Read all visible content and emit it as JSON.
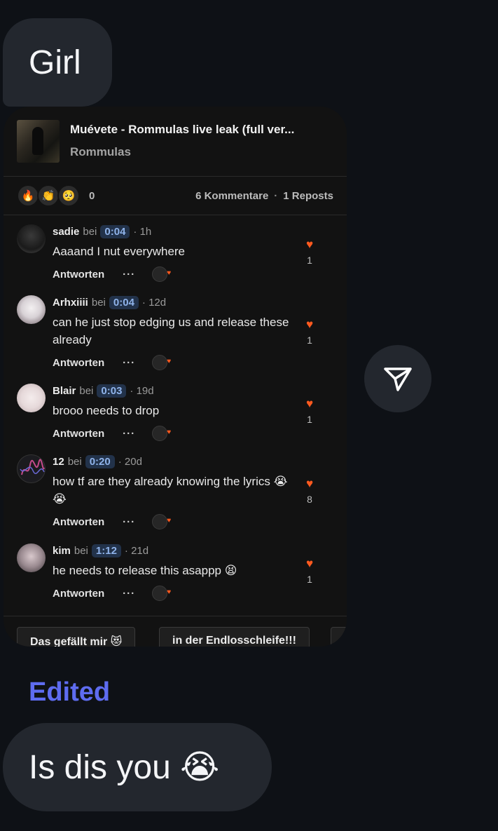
{
  "messages": {
    "top_text": "Girl",
    "edited_label": "Edited",
    "bottom_text": "Is dis you 😭"
  },
  "track": {
    "title": "Muévete - Rommulas live leak (full ver...",
    "artist": "Rommulas"
  },
  "stats": {
    "reactions": [
      "🔥",
      "👏",
      "🥺"
    ],
    "reaction_count": "0",
    "comments": "6 Kommentare",
    "separator": "·",
    "reposts": "1 Reposts"
  },
  "labels": {
    "at": "bei",
    "reply": "Antworten",
    "more": "···"
  },
  "comments": [
    {
      "user": "sadie",
      "time": "0:04",
      "ago": "· 1h",
      "text": "Aaaand I nut everywhere",
      "likes": "1"
    },
    {
      "user": "Arhxiiii",
      "time": "0:04",
      "ago": "· 12d",
      "text": "can he just stop edging us and release these already",
      "likes": "1"
    },
    {
      "user": "Blair",
      "time": "0:03",
      "ago": "· 19d",
      "text": "brooo needs to drop",
      "likes": "1"
    },
    {
      "user": "12",
      "time": "0:20",
      "ago": "· 20d",
      "text": "how tf are they already knowing the lyrics 😭😭",
      "likes": "8"
    },
    {
      "user": "kim",
      "time": "1:12",
      "ago": "· 21d",
      "text": "he needs to release this asappp 😫",
      "likes": "1"
    }
  ],
  "quick_replies": [
    "Das gefällt mir 😻",
    "in der Endlosschleife!!!"
  ],
  "colors": {
    "accent_orange": "#ff5a1f",
    "edited_blue": "#5e6cf0",
    "bubble": "#23272e"
  }
}
